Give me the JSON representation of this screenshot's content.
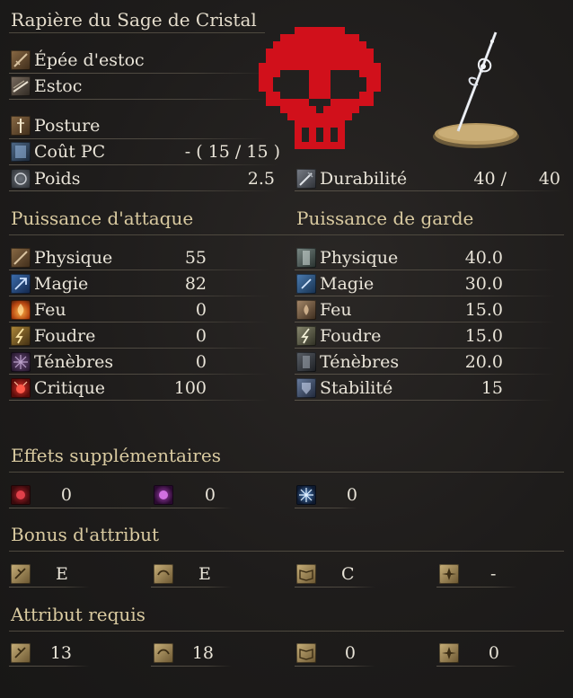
{
  "title": "Rapière du Sage de Cristal",
  "info": {
    "weapon_type": "Épée d'estoc",
    "attack_type": "Estoc",
    "skill": "Posture",
    "fp_label": "Coût PC",
    "fp_value": "- ( 15 / 15 )",
    "weight_label": "Poids",
    "weight_value": "2.5",
    "durability_label": "Durabilité",
    "durability_current": "40 /",
    "durability_max": "40"
  },
  "attack": {
    "header": "Puissance d'attaque",
    "rows": [
      {
        "label": "Physique",
        "value": "55"
      },
      {
        "label": "Magie",
        "value": "82"
      },
      {
        "label": "Feu",
        "value": "0"
      },
      {
        "label": "Foudre",
        "value": "0"
      },
      {
        "label": "Ténèbres",
        "value": "0"
      },
      {
        "label": "Critique",
        "value": "100"
      }
    ]
  },
  "guard": {
    "header": "Puissance de garde",
    "rows": [
      {
        "label": "Physique",
        "value": "40.0"
      },
      {
        "label": "Magie",
        "value": "30.0"
      },
      {
        "label": "Feu",
        "value": "15.0"
      },
      {
        "label": "Foudre",
        "value": "15.0"
      },
      {
        "label": "Ténèbres",
        "value": "20.0"
      },
      {
        "label": "Stabilité",
        "value": "15"
      }
    ]
  },
  "effects": {
    "header": "Effets supplémentaires",
    "values": [
      "0",
      "0",
      "0"
    ]
  },
  "bonus": {
    "header": "Bonus d'attribut",
    "values": [
      "E",
      "E",
      "C",
      "-"
    ]
  },
  "requirements": {
    "header": "Attribut requis",
    "values": [
      "13",
      "18",
      "0",
      "0"
    ]
  },
  "colors": {
    "header_gold": "#d9caa0",
    "skull_red": "#d1101b"
  },
  "icons": {
    "overlay": "red-pixel-skull-icon",
    "weapon": "crystal-rapier-icon"
  }
}
